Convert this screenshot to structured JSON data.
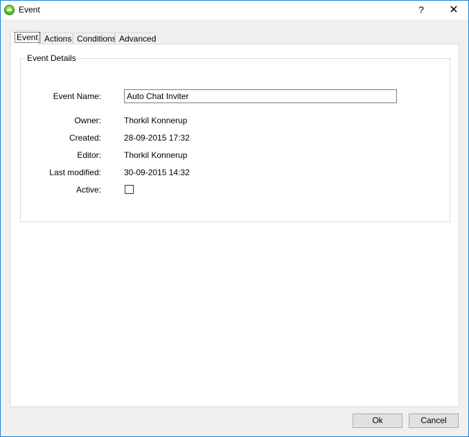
{
  "window": {
    "title": "Event",
    "help_label": "?",
    "close_label": "✕"
  },
  "tabs": [
    {
      "label": "Event",
      "active": true
    },
    {
      "label": "Actions",
      "active": false
    },
    {
      "label": "Conditions",
      "active": false
    },
    {
      "label": "Advanced",
      "active": false
    }
  ],
  "details": {
    "group_title": "Event Details",
    "event_name_label": "Event Name:",
    "event_name_value": "Auto Chat Inviter",
    "owner_label": "Owner:",
    "owner_value": "Thorkil Konnerup",
    "created_label": "Created:",
    "created_value": "28-09-2015 17:32",
    "editor_label": "Editor:",
    "editor_value": "Thorkil Konnerup",
    "last_modified_label": "Last modified:",
    "last_modified_value": "30-09-2015 14:32",
    "active_label": "Active:",
    "active_checked": false
  },
  "buttons": {
    "ok_label": "Ok",
    "cancel_label": "Cancel"
  },
  "colors": {
    "window_border": "#1883d7",
    "dialog_bg": "#f0f0f0",
    "panel_bg": "#ffffff"
  }
}
